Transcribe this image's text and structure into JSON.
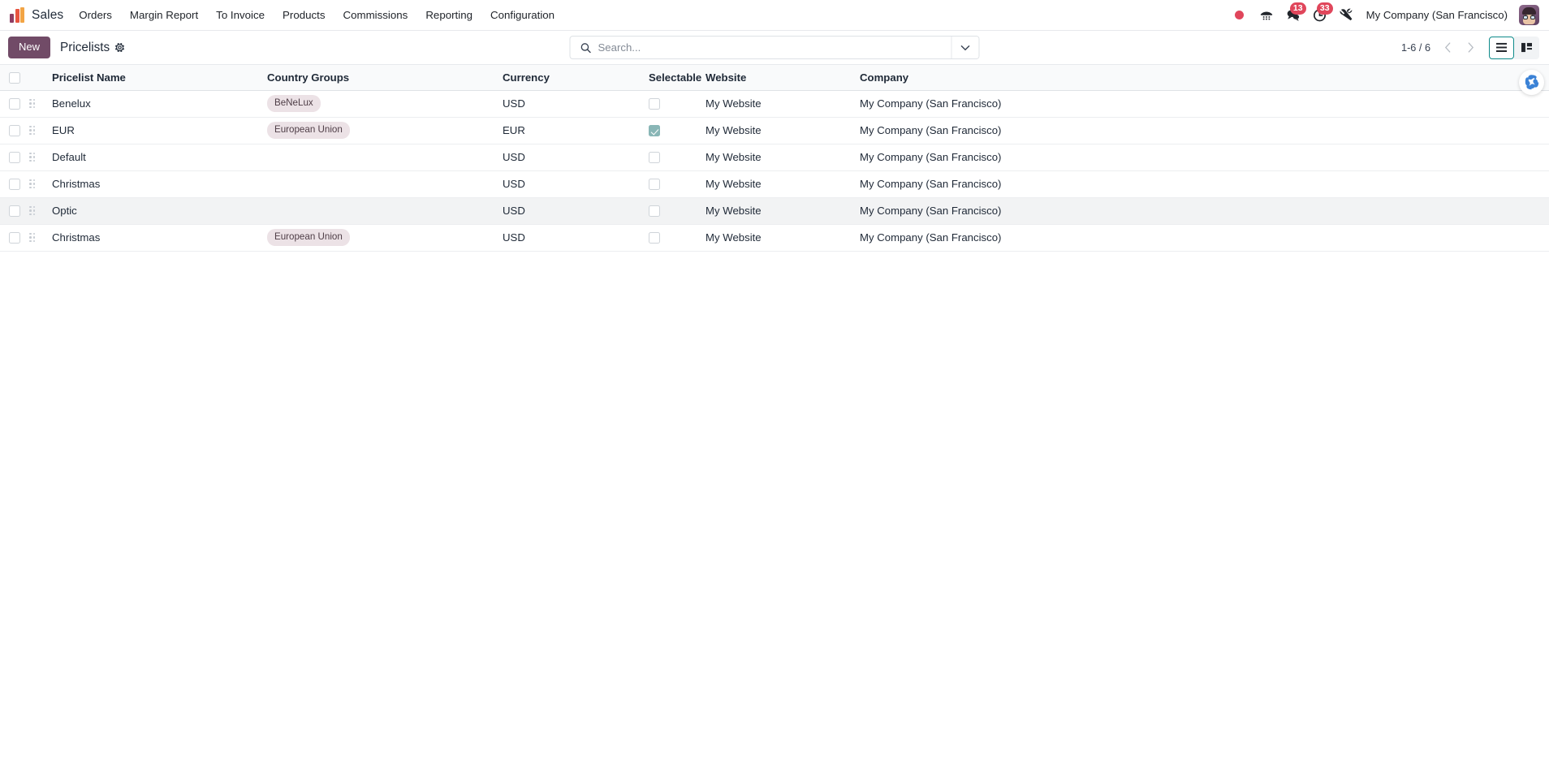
{
  "navbar": {
    "brand": "Sales",
    "logo_icon": "odoo-sales-bars-logo",
    "menu": [
      {
        "label": "Orders"
      },
      {
        "label": "Margin Report"
      },
      {
        "label": "To Invoice"
      },
      {
        "label": "Products"
      },
      {
        "label": "Commissions"
      },
      {
        "label": "Reporting"
      },
      {
        "label": "Configuration"
      }
    ],
    "status_dot_color": "#e0465b",
    "systray": [
      {
        "name": "recording-status-dot",
        "icon": "red-dot",
        "badge": ""
      },
      {
        "name": "voip-dialpad",
        "icon": "phone-dialpad-icon",
        "badge": ""
      },
      {
        "name": "messages",
        "icon": "chat-bubble-icon",
        "badge": "13"
      },
      {
        "name": "activities",
        "icon": "clock-icon",
        "badge": "33"
      },
      {
        "name": "developer-tools",
        "icon": "wrench-icon",
        "badge": ""
      }
    ],
    "company": "My Company (San Francisco)",
    "avatar_alt": "user-avatar"
  },
  "control_panel": {
    "new_label": "New",
    "breadcrumb": "Pricelists",
    "settings_icon": "gear-icon",
    "search": {
      "placeholder": "Search...",
      "value": "",
      "icon": "search-icon",
      "toggle_icon": "caret-down-icon"
    },
    "pager": {
      "value": "1-6 / 6",
      "prev_icon": "chevron-left-icon",
      "next_icon": "chevron-right-icon"
    },
    "views": [
      {
        "name": "list-view",
        "icon": "list-icon",
        "active": true
      },
      {
        "name": "kanban-view",
        "icon": "kanban-icon",
        "active": false
      }
    ]
  },
  "list": {
    "columns": [
      "Pricelist Name",
      "Country Groups",
      "Currency",
      "Selectable",
      "Website",
      "Company"
    ],
    "rows": [
      {
        "name": "Benelux",
        "country_groups": [
          "BeNeLux"
        ],
        "currency": "USD",
        "selectable": false,
        "website": "My Website",
        "company": "My Company (San Francisco)",
        "hovered": false
      },
      {
        "name": "EUR",
        "country_groups": [
          "European Union"
        ],
        "currency": "EUR",
        "selectable": true,
        "website": "My Website",
        "company": "My Company (San Francisco)",
        "hovered": false
      },
      {
        "name": "Default",
        "country_groups": [],
        "currency": "USD",
        "selectable": false,
        "website": "My Website",
        "company": "My Company (San Francisco)",
        "hovered": false
      },
      {
        "name": "Christmas",
        "country_groups": [],
        "currency": "USD",
        "selectable": false,
        "website": "My Website",
        "company": "My Company (San Francisco)",
        "hovered": false
      },
      {
        "name": "Optic",
        "country_groups": [],
        "currency": "USD",
        "selectable": false,
        "website": "My Website",
        "company": "My Company (San Francisco)",
        "hovered": true
      },
      {
        "name": "Christmas",
        "country_groups": [
          "European Union"
        ],
        "currency": "USD",
        "selectable": false,
        "website": "My Website",
        "company": "My Company (San Francisco)",
        "hovered": false
      }
    ]
  },
  "ai_assistant": {
    "icon": "odoo-ai-swirl-icon",
    "color": "#3b82d6"
  },
  "colors": {
    "brand_purple": "#714b67",
    "accent_teal": "#0d8a8a",
    "badge_red": "#e0465b",
    "tag_bg": "#ece2e6"
  }
}
